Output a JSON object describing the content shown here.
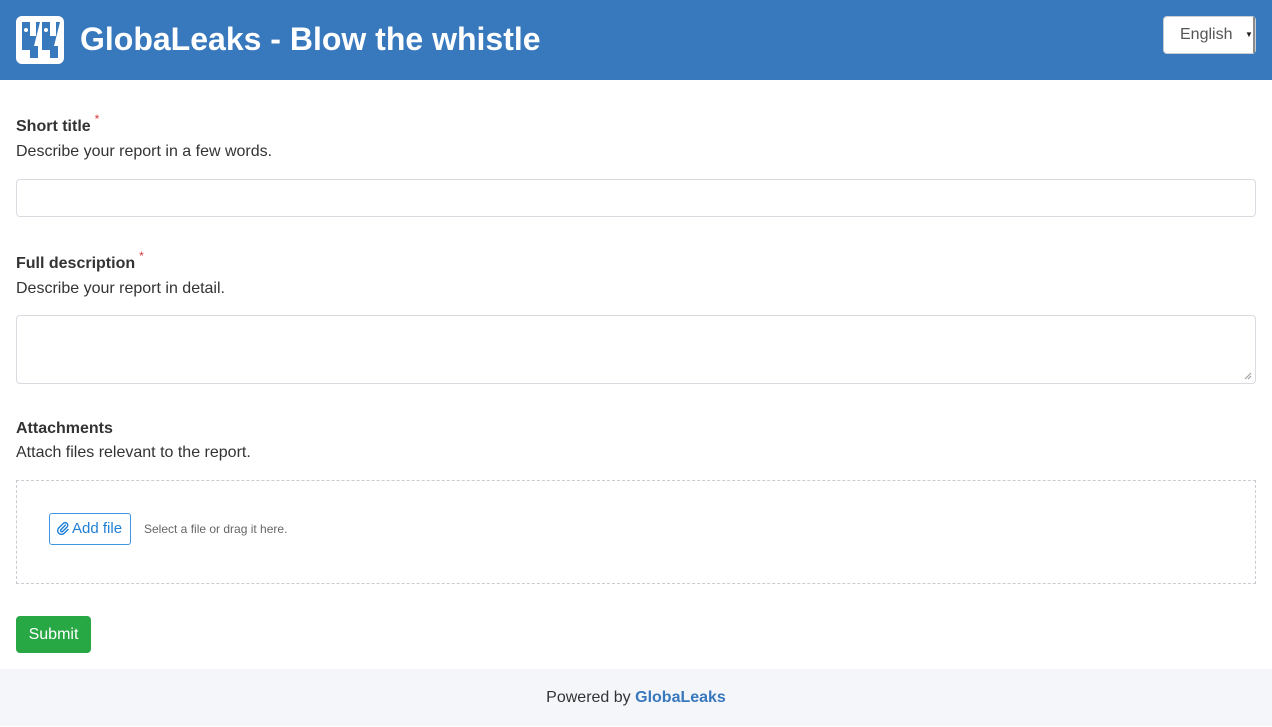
{
  "header": {
    "title": "GlobaLeaks - Blow the whistle",
    "logo_icon": "globaleaks-logo-icon",
    "background_color": "#3878bd",
    "language": {
      "selected": "English"
    }
  },
  "form": {
    "short_title": {
      "label": "Short title",
      "required_mark": "*",
      "hint": "Describe your report in a few words.",
      "value": ""
    },
    "full_description": {
      "label": "Full description",
      "required_mark": "*",
      "hint": "Describe your report in detail.",
      "value": ""
    },
    "attachments": {
      "label": "Attachments",
      "hint": "Attach files relevant to the report.",
      "add_file_label": "Add file",
      "add_file_icon": "paperclip-icon",
      "drop_hint": "Select a file or drag it here."
    },
    "submit_label": "Submit",
    "submit_color": "#28a745"
  },
  "footer": {
    "prefix": "Powered by",
    "link_text": "GlobaLeaks"
  }
}
